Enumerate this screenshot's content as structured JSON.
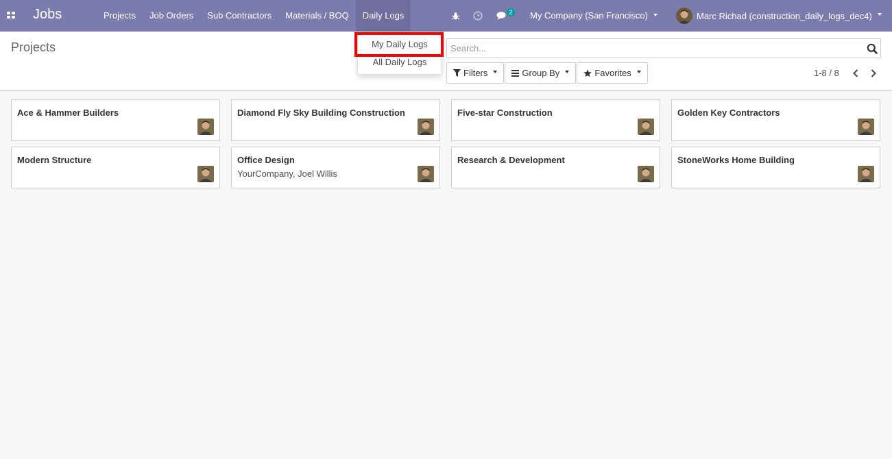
{
  "navbar": {
    "brand": "Jobs",
    "menu": [
      "Projects",
      "Job Orders",
      "Sub Contractors",
      "Materials / BOQ",
      "Daily Logs"
    ],
    "messages_count": "2",
    "company": "My Company (San Francisco)",
    "user": "Marc Richad (construction_daily_logs_dec4)",
    "bg_color": "#7c7bad"
  },
  "dropdown": {
    "items": [
      "My Daily Logs",
      "All Daily Logs"
    ],
    "highlight_color": "#ff0000"
  },
  "control_panel": {
    "breadcrumb": "Projects",
    "search_placeholder": "Search...",
    "filters_label": "Filters",
    "group_by_label": "Group By",
    "favorites_label": "Favorites",
    "pager": "1-8 / 8"
  },
  "cards": [
    {
      "title": "Ace & Hammer Builders",
      "subtitle": ""
    },
    {
      "title": "Diamond Fly Sky Building Construction",
      "subtitle": ""
    },
    {
      "title": "Five-star Construction",
      "subtitle": ""
    },
    {
      "title": "Golden Key Contractors",
      "subtitle": ""
    },
    {
      "title": "Modern Structure",
      "subtitle": ""
    },
    {
      "title": "Office Design",
      "subtitle": "YourCompany, Joel Willis"
    },
    {
      "title": "Research & Development",
      "subtitle": ""
    },
    {
      "title": "StoneWorks Home Building",
      "subtitle": ""
    }
  ]
}
